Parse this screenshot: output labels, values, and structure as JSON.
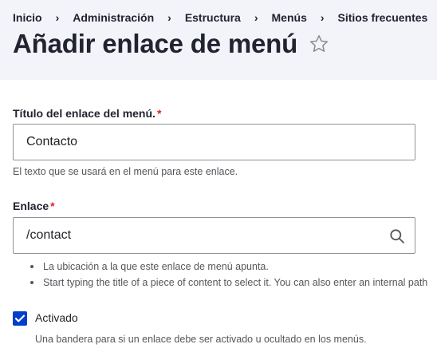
{
  "breadcrumb": {
    "items": [
      "Inicio",
      "Administración",
      "Estructura",
      "Menús",
      "Sitios frecuentes"
    ],
    "separator": "›"
  },
  "page": {
    "title": "Añadir enlace de menú",
    "favorite_icon": "star-outline-icon"
  },
  "form": {
    "title_field": {
      "label": "Título del enlace del menú.",
      "required_marker": "*",
      "value": "Contacto",
      "description": "El texto que se usará en el menú para este enlace."
    },
    "link_field": {
      "label": "Enlace",
      "required_marker": "*",
      "value": "/contact",
      "icon": "search-icon",
      "hints": [
        "La ubicación a la que este enlace de menú apunta.",
        "Start typing the title of a piece of content to select it. You can also enter an internal path"
      ]
    },
    "enabled_checkbox": {
      "label": "Activado",
      "checked": true,
      "description": "Una bandera para si un enlace debe ser activado u ocultado en los menús."
    }
  },
  "colors": {
    "header_bg": "#f3f4f9",
    "required": "#dc2323",
    "checkbox": "#003ecc",
    "text": "#232429",
    "muted": "#55565b"
  }
}
